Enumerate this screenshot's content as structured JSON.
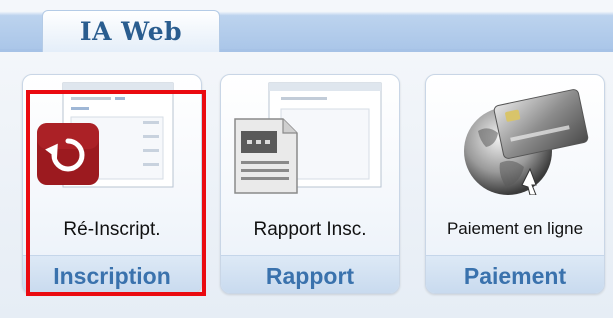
{
  "tab": {
    "label": "IA Web"
  },
  "cards": [
    {
      "label": "Ré-Inscript.",
      "category": "Inscription",
      "icon": "refresh-icon"
    },
    {
      "label": "Rapport Insc.",
      "category": "Rapport",
      "icon": "report-document-icon"
    },
    {
      "label": "Paiement en ligne",
      "category": "Paiement",
      "icon": "credit-card-globe-icon"
    }
  ],
  "colors": {
    "tab_text": "#2a5d8f",
    "band_text": "#3a72ad",
    "highlight": "#ea0a10",
    "refresh_icon_bg": "#9c1a1f"
  }
}
